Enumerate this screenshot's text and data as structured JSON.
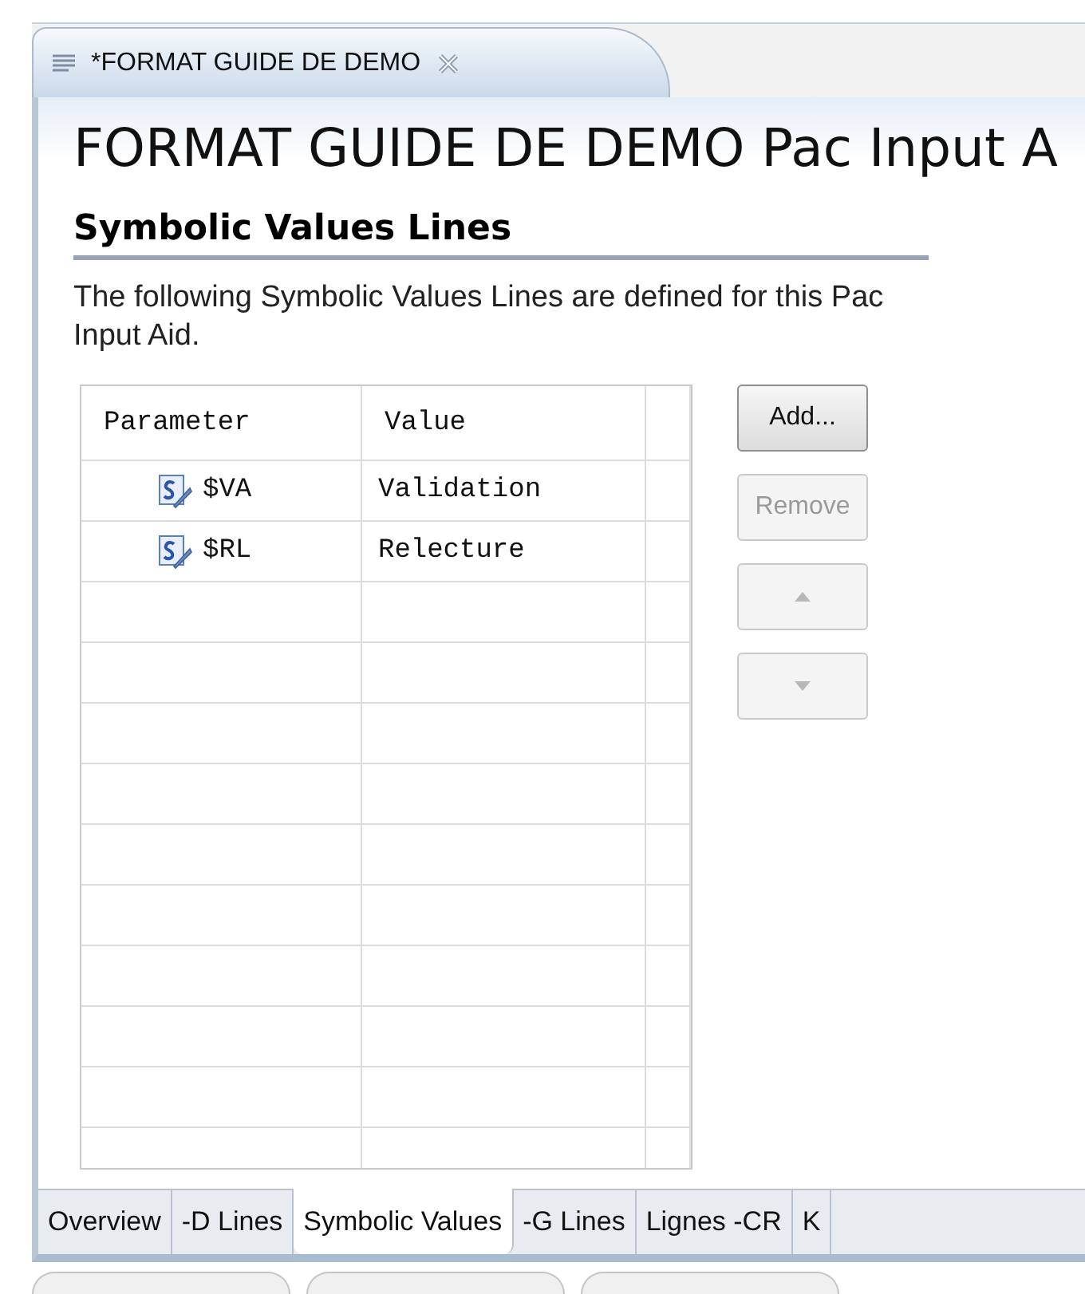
{
  "editor_tab": {
    "title": "*FORMAT GUIDE DE DEMO",
    "dirty": true
  },
  "page_title": "FORMAT GUIDE DE DEMO Pac Input A",
  "section": {
    "heading": "Symbolic Values Lines",
    "description": "The following Symbolic Values Lines are defined for this Pac Input Aid."
  },
  "table": {
    "columns": [
      "Parameter",
      "Value"
    ],
    "rows": [
      {
        "parameter": "$VA",
        "value": "Validation"
      },
      {
        "parameter": "$RL",
        "value": "Relecture"
      }
    ]
  },
  "buttons": [
    {
      "kind": "text",
      "label": "Add...",
      "disabled": false
    },
    {
      "kind": "text",
      "label": "Remove",
      "disabled": true
    },
    {
      "kind": "up",
      "disabled": true
    },
    {
      "kind": "down",
      "disabled": true
    }
  ],
  "page_tabs": [
    {
      "label": "Overview",
      "selected": false
    },
    {
      "label": "-D Lines",
      "selected": false
    },
    {
      "label": "Symbolic Values",
      "selected": true
    },
    {
      "label": "-G Lines",
      "selected": false
    },
    {
      "label": "Lignes -CR",
      "selected": false
    },
    {
      "label": "K",
      "selected": false
    }
  ]
}
